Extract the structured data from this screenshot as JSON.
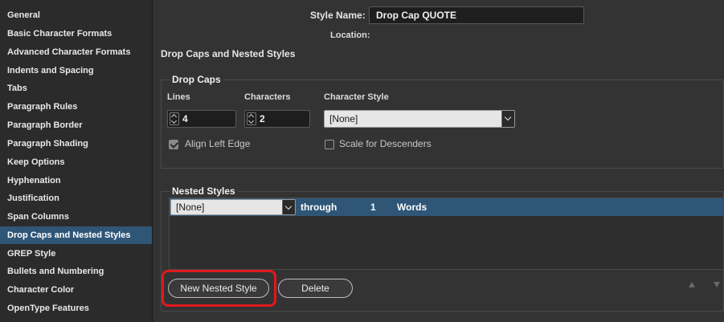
{
  "sidebar": {
    "items": [
      {
        "label": "General"
      },
      {
        "label": "Basic Character Formats"
      },
      {
        "label": "Advanced Character Formats"
      },
      {
        "label": "Indents and Spacing"
      },
      {
        "label": "Tabs"
      },
      {
        "label": "Paragraph Rules"
      },
      {
        "label": "Paragraph Border"
      },
      {
        "label": "Paragraph Shading"
      },
      {
        "label": "Keep Options"
      },
      {
        "label": "Hyphenation"
      },
      {
        "label": "Justification"
      },
      {
        "label": "Span Columns"
      },
      {
        "label": "Drop Caps and Nested Styles",
        "selected": true
      },
      {
        "label": "GREP Style"
      },
      {
        "label": "Bullets and Numbering"
      },
      {
        "label": "Character Color"
      },
      {
        "label": "OpenType Features"
      }
    ],
    "selected_color": "#2f5677"
  },
  "header": {
    "style_name_label": "Style Name:",
    "style_name_value": "Drop Cap QUOTE",
    "location_label": "Location:"
  },
  "section_title": "Drop Caps and Nested Styles",
  "drop_caps": {
    "title": "Drop Caps",
    "lines_label": "Lines",
    "lines_value": "4",
    "characters_label": "Characters",
    "characters_value": "2",
    "character_style_label": "Character Style",
    "character_style_value": "[None]",
    "align_left_edge_label": "Align Left Edge",
    "align_left_edge_checked": true,
    "scale_descenders_label": "Scale for Descenders",
    "scale_descenders_checked": false
  },
  "nested_styles": {
    "title": "Nested Styles",
    "rows": [
      {
        "style": "[None]",
        "through": "through",
        "count": "1",
        "unit": "Words"
      }
    ],
    "new_button": "New Nested Style",
    "delete_button": "Delete",
    "highlight_color": "#e0191e"
  },
  "icons": {
    "move_up": "triangle-up-icon",
    "move_down": "triangle-down-icon"
  }
}
